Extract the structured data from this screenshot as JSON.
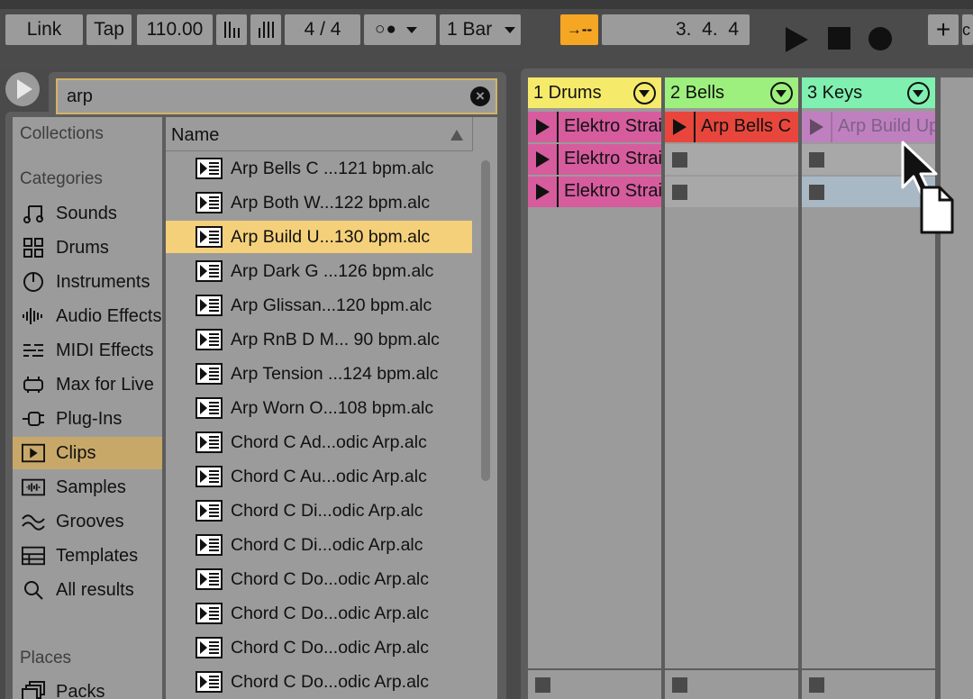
{
  "transport": {
    "link": "Link",
    "tap": "Tap",
    "tempo": "110.00",
    "signature": "4 / 4",
    "metronome": "○●",
    "quantize": "1 Bar",
    "position": "3.  4.  4",
    "follow_icon": "→--",
    "add": "+",
    "right_partial": "c"
  },
  "search": {
    "query": "arp",
    "clear_icon": "⊗"
  },
  "sidebar": {
    "collections_heading": "Collections",
    "categories_heading": "Categories",
    "categories": [
      {
        "label": "Sounds",
        "icon": "note-icon"
      },
      {
        "label": "Drums",
        "icon": "drums-grid-icon"
      },
      {
        "label": "Instruments",
        "icon": "instrument-icon"
      },
      {
        "label": "Audio Effects",
        "icon": "audio-effects-icon"
      },
      {
        "label": "MIDI Effects",
        "icon": "midi-effects-icon"
      },
      {
        "label": "Max for Live",
        "icon": "max-for-live-icon"
      },
      {
        "label": "Plug-Ins",
        "icon": "plugin-icon"
      },
      {
        "label": "Clips",
        "icon": "clip-icon",
        "selected": true
      },
      {
        "label": "Samples",
        "icon": "samples-icon"
      },
      {
        "label": "Grooves",
        "icon": "grooves-icon"
      },
      {
        "label": "Templates",
        "icon": "templates-icon"
      },
      {
        "label": "All results",
        "icon": "search-icon"
      }
    ],
    "places_heading": "Places",
    "places": [
      {
        "label": "Packs",
        "icon": "packs-icon"
      }
    ]
  },
  "filelist": {
    "column_name": "Name",
    "files": [
      "Arp Bells C ...121 bpm.alc",
      "Arp Both W...122 bpm.alc",
      "Arp Build U...130 bpm.alc",
      "Arp Dark G ...126 bpm.alc",
      "Arp Glissan...120 bpm.alc",
      "Arp RnB D M... 90 bpm.alc",
      "Arp Tension ...124 bpm.alc",
      "Arp Worn O...108 bpm.alc",
      "Chord C Ad...odic Arp.alc",
      "Chord C Au...odic Arp.alc",
      "Chord C Di...odic Arp.alc",
      "Chord C Di...odic Arp.alc",
      "Chord C Do...odic Arp.alc",
      "Chord C Do...odic Arp.alc",
      "Chord C Do...odic Arp.alc",
      "Chord C Do...odic Arp.alc"
    ],
    "selected_index": 2
  },
  "tracks": [
    {
      "name": "1 Drums",
      "color": "#f6ea6a",
      "slots": [
        {
          "type": "clip",
          "name": "Elektro Straight",
          "color": "#d65c9e"
        },
        {
          "type": "clip",
          "name": "Elektro Straight",
          "color": "#d65c9e"
        },
        {
          "type": "clip",
          "name": "Elektro Straight",
          "color": "#d65c9e"
        },
        {
          "type": "none"
        }
      ]
    },
    {
      "name": "2 Bells",
      "color": "#9df07e",
      "slots": [
        {
          "type": "clip",
          "name": "Arp Bells C",
          "color": "#e8463c"
        },
        {
          "type": "empty"
        },
        {
          "type": "empty"
        },
        {
          "type": "none"
        }
      ]
    },
    {
      "name": "3 Keys",
      "color": "#7ff0b0",
      "slots": [
        {
          "type": "clip",
          "name": "Arp Build Up",
          "color": "#c47ec3",
          "ghost": true
        },
        {
          "type": "empty"
        },
        {
          "type": "empty",
          "highlight": true
        },
        {
          "type": "none"
        }
      ]
    }
  ]
}
